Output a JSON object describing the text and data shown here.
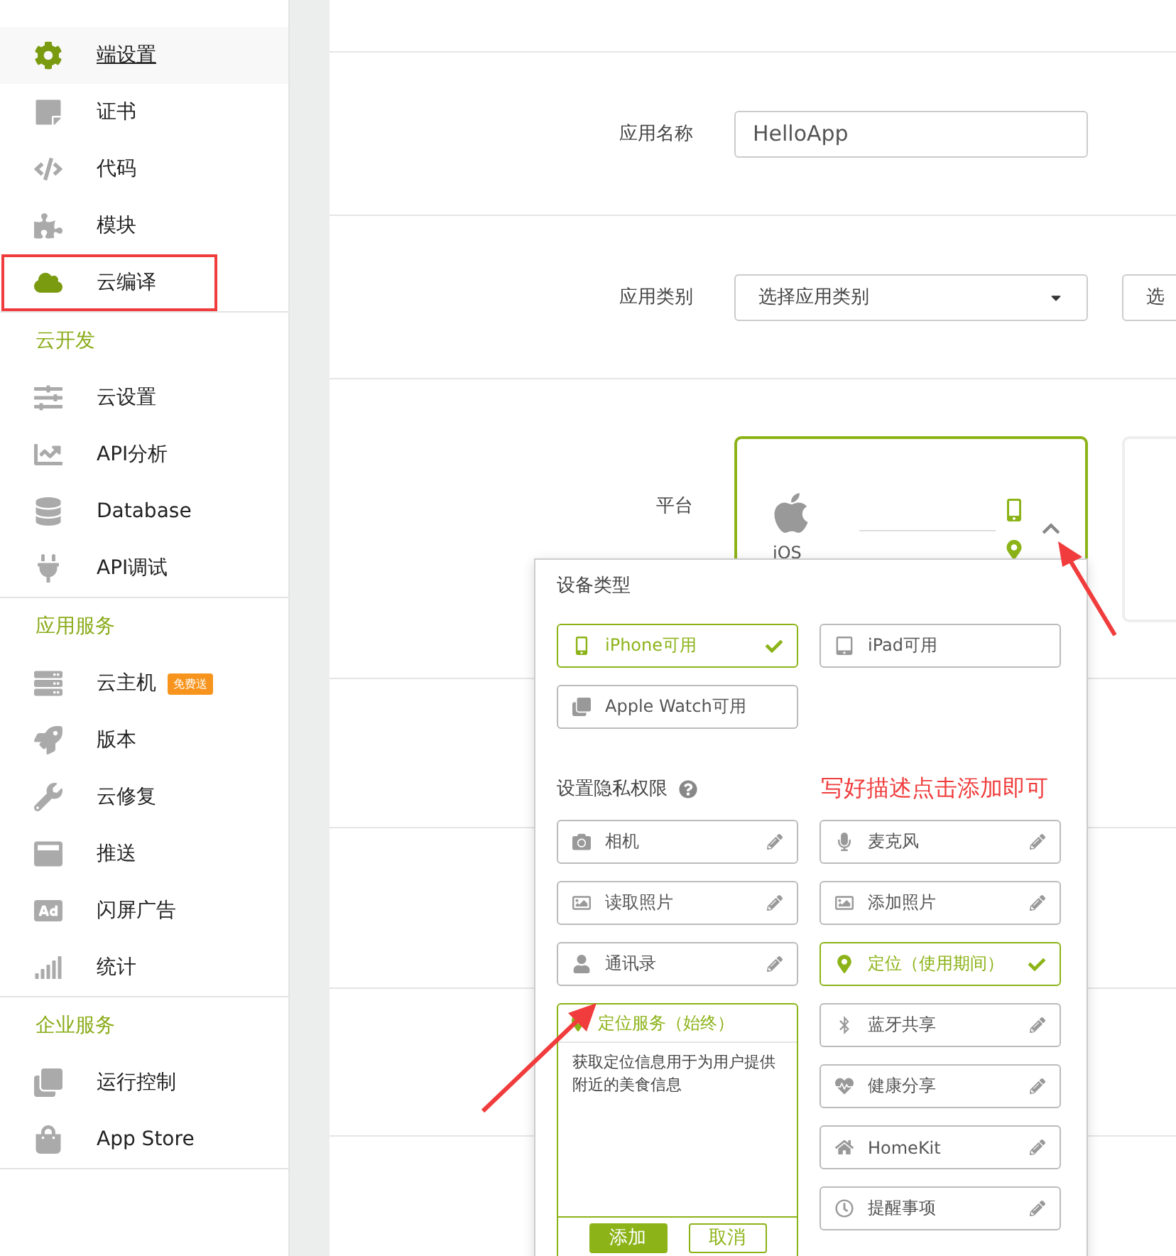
{
  "sidebar": {
    "sections": [
      {
        "items": [
          {
            "label": "端设置",
            "selected": true,
            "highlighted": false
          },
          {
            "label": "证书",
            "selected": false,
            "highlighted": false
          },
          {
            "label": "代码",
            "selected": false,
            "highlighted": false
          },
          {
            "label": "模块",
            "selected": false,
            "highlighted": false
          },
          {
            "label": "云编译",
            "selected": false,
            "highlighted": true
          }
        ]
      },
      {
        "title": "云开发",
        "items": [
          {
            "label": "云设置",
            "selected": false,
            "highlighted": false
          },
          {
            "label": "API分析",
            "selected": false,
            "highlighted": false
          },
          {
            "label": "Database",
            "selected": false,
            "highlighted": false
          },
          {
            "label": "API调试",
            "selected": false,
            "highlighted": false
          }
        ]
      },
      {
        "title": "应用服务",
        "items": [
          {
            "label": "云主机",
            "badge": "免费送",
            "selected": false,
            "highlighted": false
          },
          {
            "label": "版本",
            "selected": false,
            "highlighted": false
          },
          {
            "label": "云修复",
            "selected": false,
            "highlighted": false
          },
          {
            "label": "推送",
            "selected": false,
            "highlighted": false
          },
          {
            "label": "闪屏广告",
            "selected": false,
            "highlighted": false
          },
          {
            "label": "统计",
            "selected": false,
            "highlighted": false
          }
        ]
      },
      {
        "title": "企业服务",
        "items": [
          {
            "label": "运行控制",
            "selected": false,
            "highlighted": false
          },
          {
            "label": "App Store",
            "selected": false,
            "highlighted": false
          }
        ]
      }
    ]
  },
  "form": {
    "app_name": {
      "label": "应用名称",
      "value": "HelloApp"
    },
    "category": {
      "label": "应用类别",
      "select_1": "选择应用类别",
      "select_2": "选"
    },
    "platform": {
      "label": "平台",
      "card": {
        "name": "iOS",
        "selected": true
      }
    }
  },
  "popup": {
    "device_title": "设备类型",
    "devices": [
      {
        "label": "iPhone可用",
        "selected": true
      },
      {
        "label": "iPad可用",
        "selected": false
      },
      {
        "label": "Apple Watch可用",
        "selected": false
      }
    ],
    "privacy_title": "设置隐私权限",
    "annotation": "写好描述点击添加即可",
    "permissions_left": [
      {
        "kind": "toggle",
        "label": "相机",
        "checked": false
      },
      {
        "kind": "toggle",
        "label": "读取照片",
        "checked": false
      },
      {
        "kind": "toggle",
        "label": "通讯录",
        "checked": false
      },
      {
        "kind": "editor",
        "label": "定位服务（始终）",
        "value": "获取定位信息用于为用户提供附近的美食信息",
        "add": "添加",
        "cancel": "取消"
      }
    ],
    "permissions_right": [
      {
        "kind": "toggle",
        "label": "麦克风",
        "checked": false
      },
      {
        "kind": "toggle",
        "label": "添加照片",
        "checked": false
      },
      {
        "kind": "toggle",
        "label": "定位（使用期间）",
        "checked": true
      },
      {
        "kind": "toggle",
        "label": "蓝牙共享",
        "checked": false
      },
      {
        "kind": "toggle",
        "label": "健康分享",
        "checked": false
      },
      {
        "kind": "toggle",
        "label": "HomeKit",
        "checked": false
      },
      {
        "kind": "toggle",
        "label": "提醒事项",
        "checked": false
      }
    ]
  }
}
